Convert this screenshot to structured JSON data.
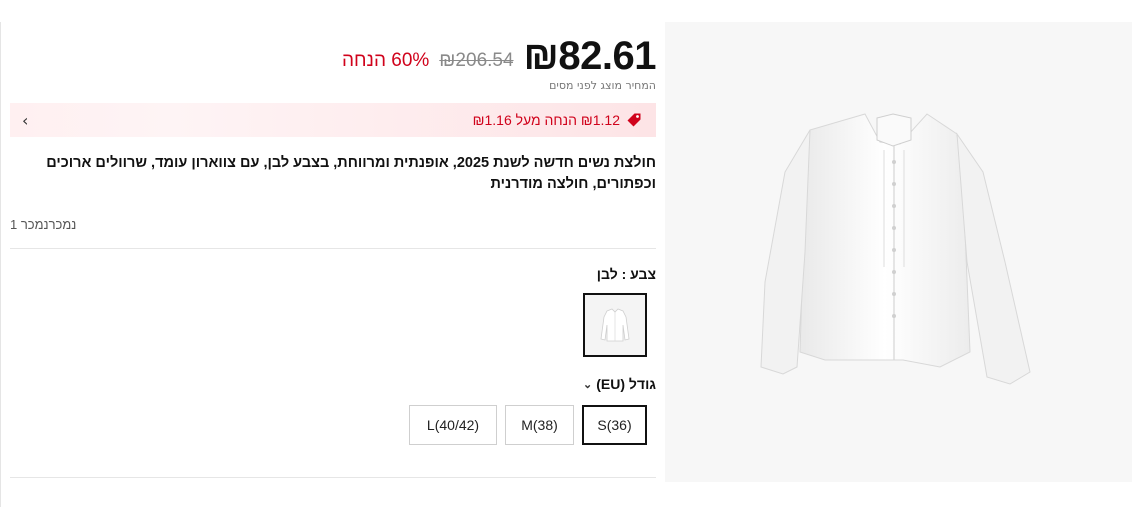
{
  "product": {
    "price": "₪82.61",
    "original_price": "₪206.54",
    "discount": "60% הנחה",
    "tax_note": "המחיר מוצג לפני מסים",
    "promo": "₪1.12 הנחה מעל ₪1.16",
    "title": "חולצת נשים חדשה לשנת 2025, אופנתית ומרווחת, בצבע לבן, עם צווארון עומד, שרוולים ארוכים וכפתורים, חולצה מודרנית",
    "sold": "נמכרנמכר 1"
  },
  "color": {
    "label": "צבע : לבן",
    "selected": "לבן"
  },
  "size": {
    "label": "גודל (EU)",
    "options": [
      "S(36)",
      "M(38)",
      "L(40/42)"
    ],
    "selected_index": 0
  },
  "colors": {
    "price_red": "#d0021b",
    "promo_bg": "#fde4e6",
    "text_dark": "#111111"
  },
  "icons": {
    "promo": "price-tag-icon",
    "promo_arrow": "chevron-right-icon",
    "size_toggle": "chevron-down-icon"
  }
}
